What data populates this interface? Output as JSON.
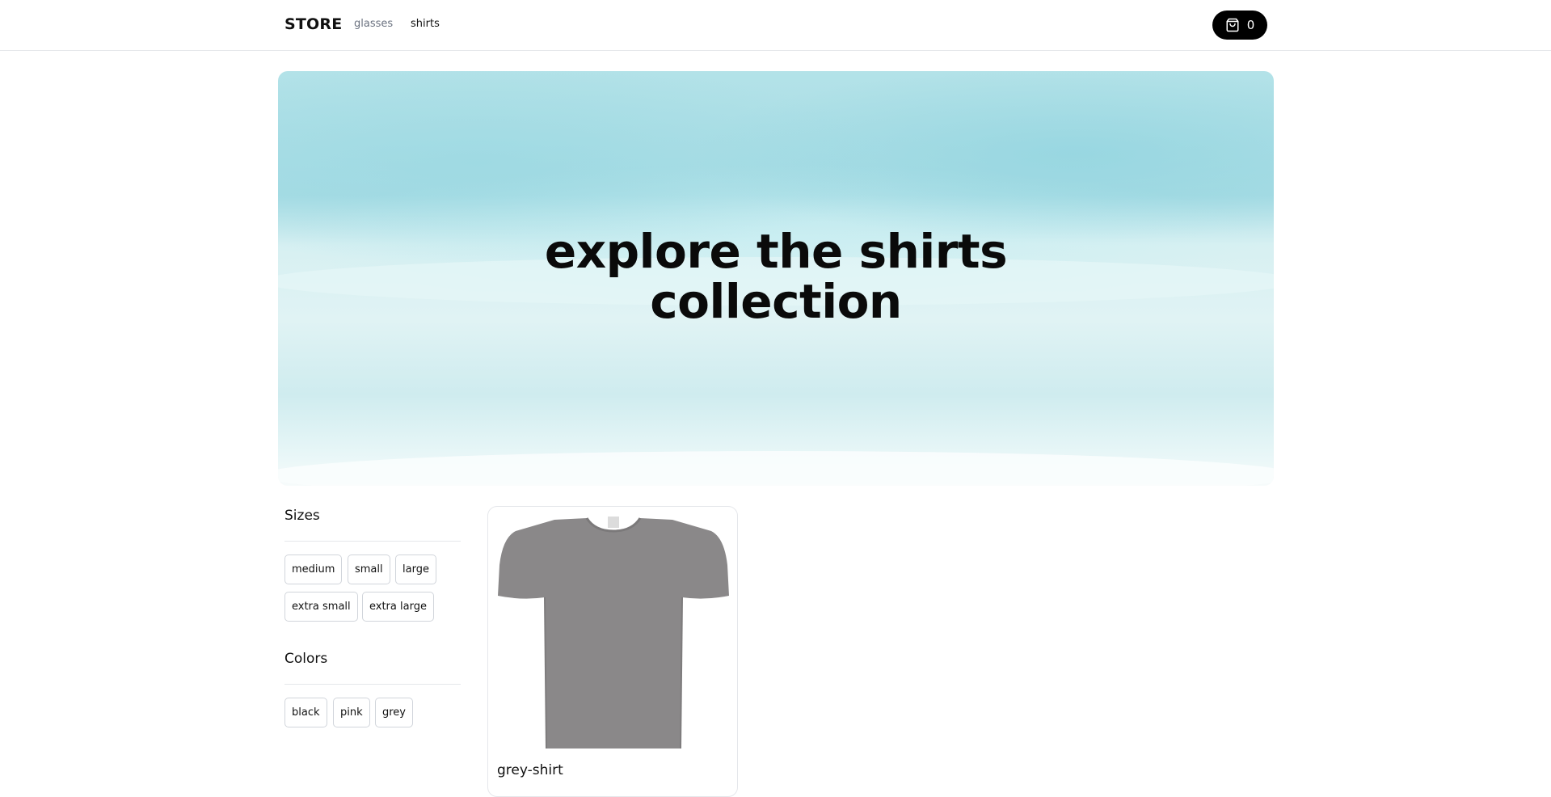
{
  "header": {
    "logo": "STORE",
    "nav": [
      {
        "label": "glasses",
        "active": false
      },
      {
        "label": "shirts",
        "active": true
      }
    ],
    "cart": {
      "icon": "shopping-bag-icon",
      "count": "0"
    }
  },
  "billboard": {
    "line1": "explore the shirts",
    "line2": "collection"
  },
  "filters": {
    "sizes": {
      "title": "Sizes",
      "options": [
        "medium",
        "small",
        "large",
        "extra small",
        "extra large"
      ]
    },
    "colors": {
      "title": "Colors",
      "options": [
        "black",
        "pink",
        "grey"
      ]
    }
  },
  "products": [
    {
      "name": "grey-shirt",
      "color": "#8a8889"
    }
  ],
  "colors": {
    "accent": "#000000",
    "border": "#e5e7eb",
    "muted_text": "#6b7280"
  }
}
